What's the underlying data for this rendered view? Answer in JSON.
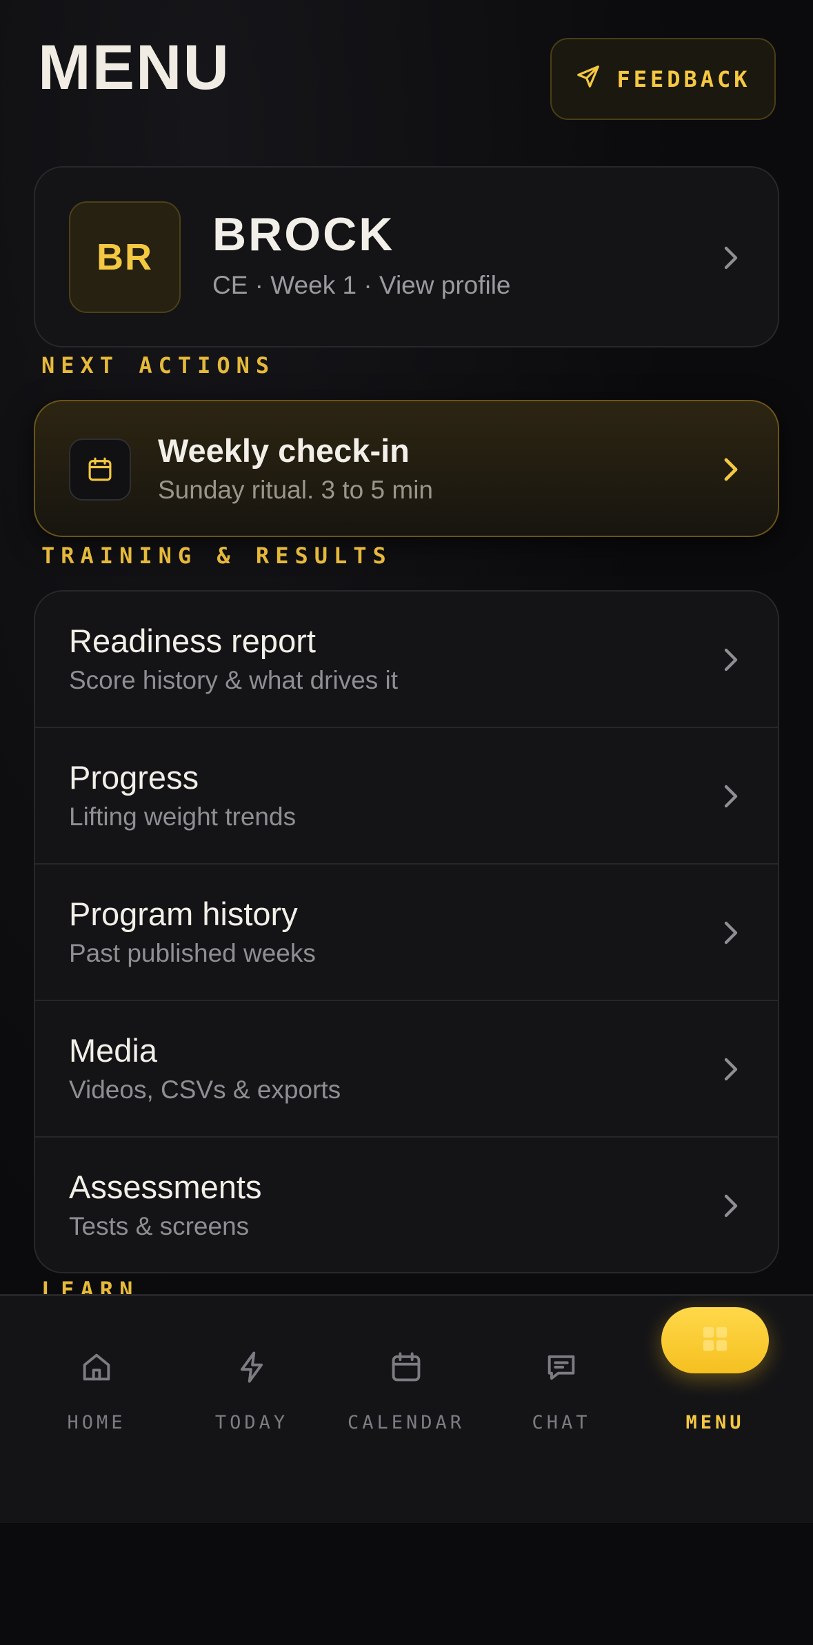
{
  "header": {
    "title": "MENU",
    "feedback_label": "FEEDBACK"
  },
  "profile": {
    "initials": "BR",
    "name": "BROCK",
    "subtitle": "CE · Week 1 · View profile"
  },
  "sections": {
    "next_actions": "NEXT ACTIONS",
    "training_results": "TRAINING & RESULTS",
    "learn": "LEARN"
  },
  "next_action": {
    "title": "Weekly check-in",
    "subtitle": "Sunday ritual. 3 to 5 min"
  },
  "training_items": [
    {
      "title": "Readiness report",
      "subtitle": "Score history & what drives it"
    },
    {
      "title": "Progress",
      "subtitle": "Lifting weight trends"
    },
    {
      "title": "Program history",
      "subtitle": "Past published weeks"
    },
    {
      "title": "Media",
      "subtitle": "Videos, CSVs & exports"
    },
    {
      "title": "Assessments",
      "subtitle": "Tests & screens"
    }
  ],
  "nav": {
    "items": [
      {
        "label": "HOME",
        "icon": "home-icon"
      },
      {
        "label": "TODAY",
        "icon": "bolt-icon"
      },
      {
        "label": "CALENDAR",
        "icon": "calendar-icon"
      },
      {
        "label": "CHAT",
        "icon": "chat-icon"
      },
      {
        "label": "MENU",
        "icon": "grid-icon",
        "active": true
      }
    ]
  },
  "colors": {
    "accent": "#f5c842",
    "background": "#0b0b0d",
    "card": "#141417",
    "muted_text": "#8f8e93"
  }
}
